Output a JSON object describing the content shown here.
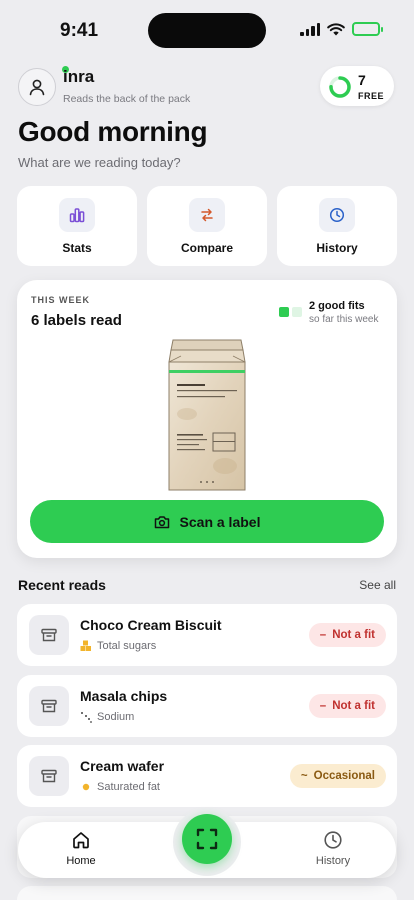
{
  "status_bar": {
    "time": "9:41"
  },
  "header": {
    "brand": "inra",
    "tagline": "Reads the back of the pack",
    "free_scans": {
      "count": "7",
      "label": "FREE",
      "ring_fraction": 0.75
    }
  },
  "greeting": {
    "title": "Good morning",
    "subtitle": "What are we reading today?"
  },
  "quick_actions": [
    {
      "label": "Stats",
      "icon": "bar-chart-icon"
    },
    {
      "label": "Compare",
      "icon": "swap-arrows-icon"
    },
    {
      "label": "History",
      "icon": "clock-icon"
    }
  ],
  "week": {
    "kicker": "THIS WEEK",
    "title": "6 labels read",
    "good_fits": "2 good fits",
    "good_fits_sub": "so far this week",
    "scan_label": "Scan a label"
  },
  "recent": {
    "title": "Recent reads",
    "see_all": "See all",
    "items": [
      {
        "name": "Choco Cream Biscuit",
        "nutrient": "Total sugars",
        "nutrient_icon": "sugar-cubes-icon",
        "verdict": "Not a fit",
        "verdict_symbol": "–",
        "tone": "bad"
      },
      {
        "name": "Masala chips",
        "nutrient": "Sodium",
        "nutrient_icon": "salt-dots-icon",
        "verdict": "Not a fit",
        "verdict_symbol": "–",
        "tone": "bad"
      },
      {
        "name": "Cream wafer",
        "nutrient": "Saturated fat",
        "nutrient_icon": "fat-drop-icon",
        "verdict": "Occasional",
        "verdict_symbol": "~",
        "tone": "ok"
      }
    ]
  },
  "tabs": {
    "home": "Home",
    "history": "History"
  },
  "colors": {
    "accent": "#2ecc52",
    "bad": "#c0312f",
    "bad_bg": "#fde6e6",
    "ok": "#8a5a12",
    "ok_bg": "#fbecd0"
  }
}
